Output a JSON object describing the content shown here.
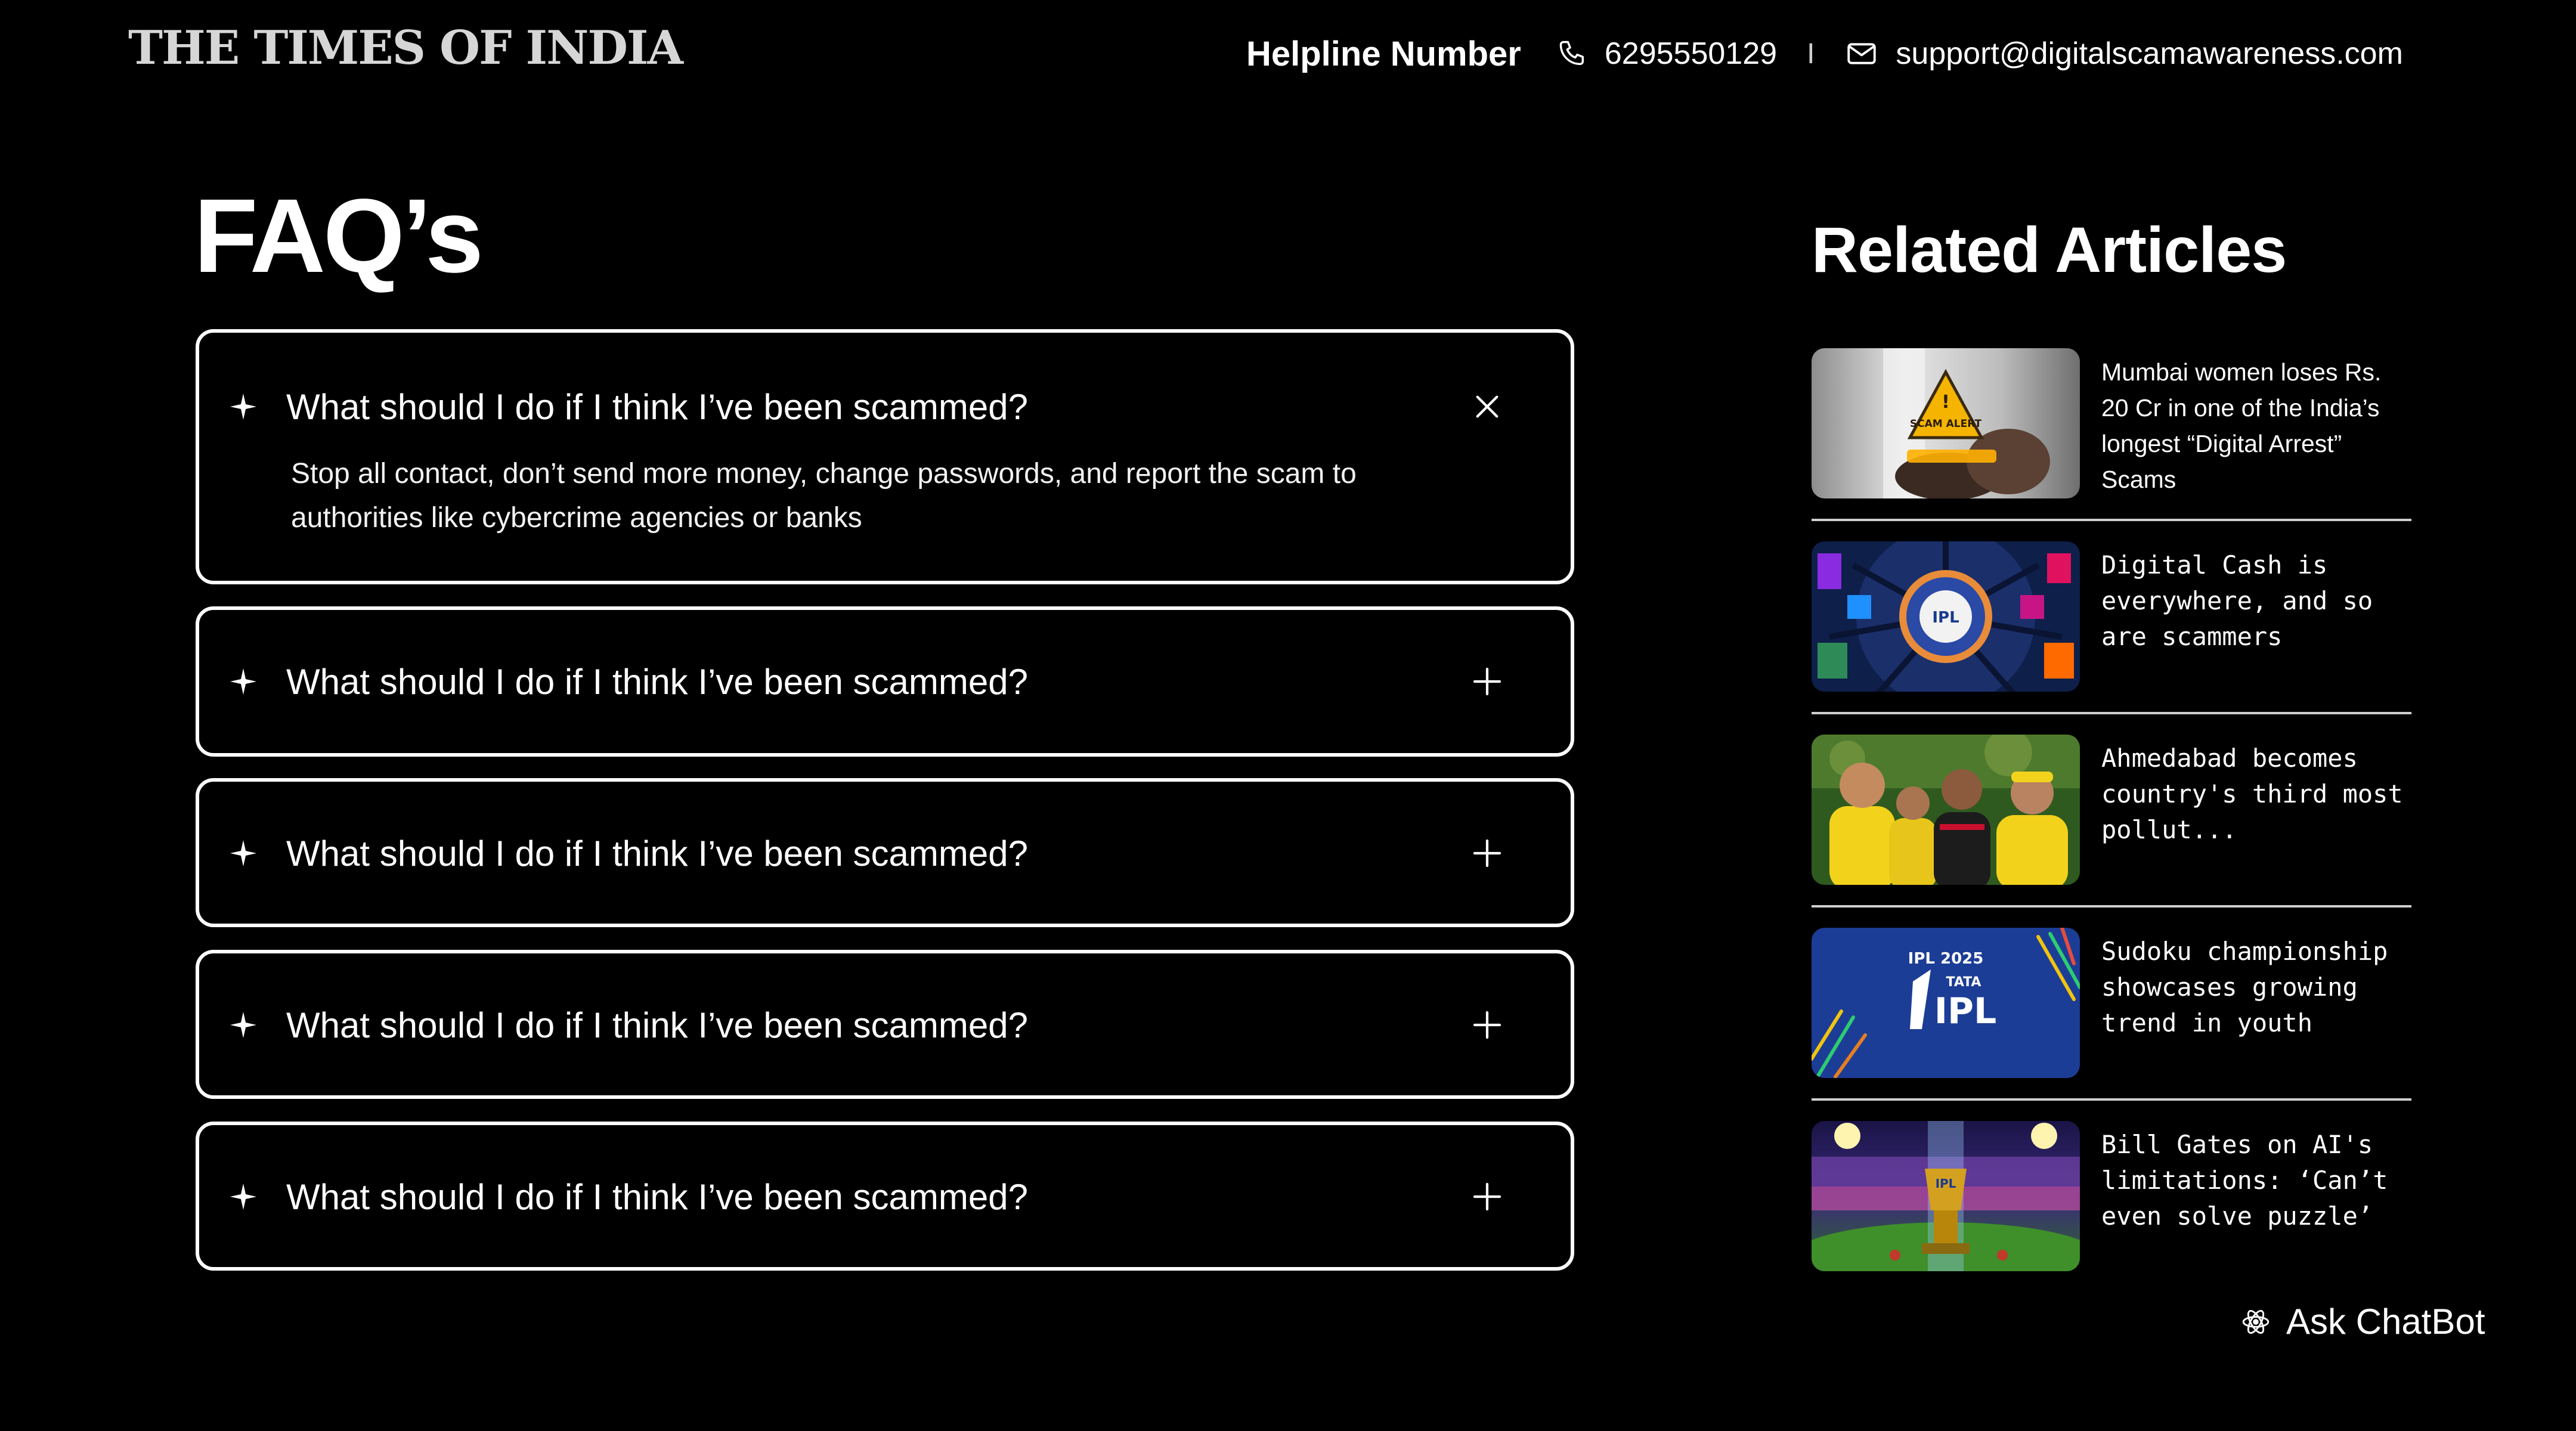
{
  "header": {
    "logo": "THE TIMES OF INDIA",
    "helpline_label": "Helpline Number",
    "phone": "6295550129",
    "separator": "I",
    "email": "support@digitalscamawareness.com"
  },
  "faq": {
    "title": "FAQ’s",
    "items": [
      {
        "question": "What should I do if I think I’ve been scammed?",
        "answer": "Stop all contact, don’t send more money, change passwords, and report the scam to authorities like cybercrime agencies or banks",
        "expanded": true,
        "toggle_icon": "close-icon"
      },
      {
        "question": "What should I do if I think I’ve been scammed?",
        "expanded": false,
        "toggle_icon": "plus-icon"
      },
      {
        "question": "What should I do if I think I’ve been scammed?",
        "expanded": false,
        "toggle_icon": "plus-icon"
      },
      {
        "question": "What should I do if I think I’ve been scammed?",
        "expanded": false,
        "toggle_icon": "plus-icon"
      },
      {
        "question": "What should I do if I think I’ve been scammed?",
        "expanded": false,
        "toggle_icon": "plus-icon"
      }
    ]
  },
  "related": {
    "title": "Related Articles",
    "articles": [
      {
        "title": "Mumbai women loses Rs. 20 Cr in one of the India’s longest “Digital Arrest” Scams",
        "thumbnail": "scam-alert-image",
        "thumb_badge": "SCAM ALERT"
      },
      {
        "title": "Digital Cash is everywhere, and so are scammers",
        "thumbnail": "ipl-wheel-image",
        "thumb_badge": "IPL"
      },
      {
        "title": "Ahmedabad becomes country's third most pollut...",
        "thumbnail": "cricket-players-image"
      },
      {
        "title": "Sudoku championship showcases growing trend in youth",
        "thumbnail": "ipl-2025-logo-image",
        "thumb_badge_top": "IPL 2025",
        "thumb_badge_brand": "TATA",
        "thumb_badge_main": "IPL"
      },
      {
        "title": "Bill Gates on AI's limitations: ‘Can’t even solve puzzle’",
        "thumbnail": "ipl-stadium-trophy-image",
        "thumb_badge": "IPL"
      }
    ]
  },
  "chatbot": {
    "label": "Ask ChatBot",
    "icon": "atom-icon"
  },
  "colors": {
    "background": "#000000",
    "text": "#ffffff",
    "logo": "#d6d6d6",
    "border": "#ffffff",
    "divider": "#cfcfcf",
    "alert_yellow": "#f4b400",
    "ipl_blue": "#1a3a8f"
  }
}
